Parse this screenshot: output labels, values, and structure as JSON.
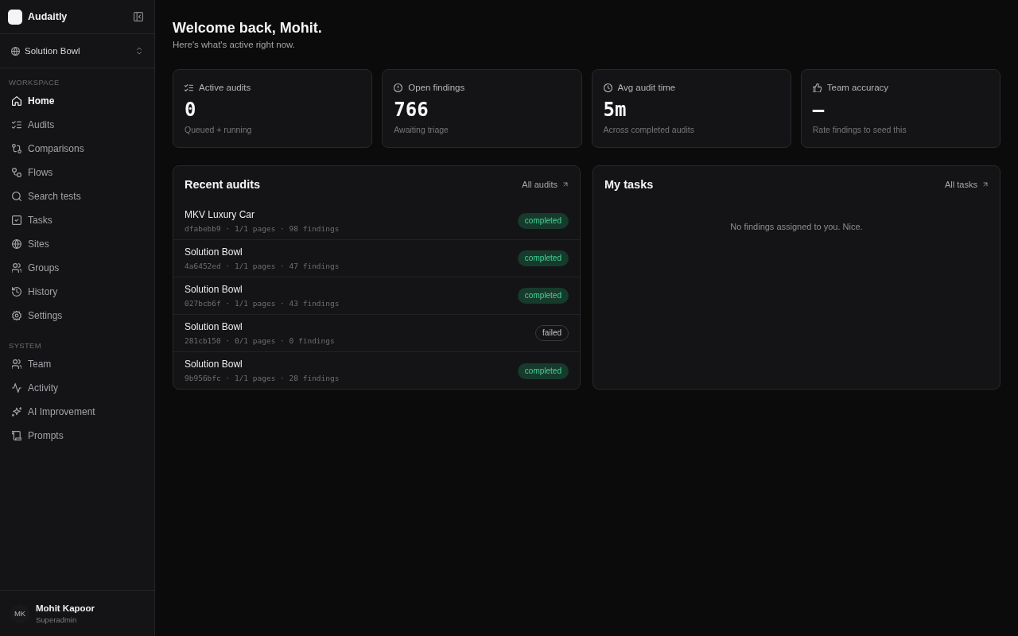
{
  "sidebar": {
    "app_name": "Audaitly",
    "workspace_switcher": {
      "label": "Solution Bowl"
    },
    "sections": [
      {
        "title": "WORKSPACE",
        "items": [
          {
            "label": "Home",
            "selected": true
          },
          {
            "label": "Audits",
            "selected": false
          },
          {
            "label": "Comparisons",
            "selected": false
          },
          {
            "label": "Flows",
            "selected": false
          },
          {
            "label": "Search tests",
            "selected": false
          },
          {
            "label": "Tasks",
            "selected": false
          },
          {
            "label": "Sites",
            "selected": false
          },
          {
            "label": "Groups",
            "selected": false
          },
          {
            "label": "History",
            "selected": false
          },
          {
            "label": "Settings",
            "selected": false
          }
        ]
      },
      {
        "title": "SYSTEM",
        "items": [
          {
            "label": "Team",
            "selected": false
          },
          {
            "label": "Activity",
            "selected": false
          },
          {
            "label": "AI Improvement",
            "selected": false
          },
          {
            "label": "Prompts",
            "selected": false
          }
        ]
      }
    ],
    "user": {
      "initials": "MK",
      "name": "Mohit Kapoor",
      "role": "Superadmin"
    }
  },
  "header": {
    "title": "Welcome back, Mohit.",
    "subtitle": "Here's what's active right now."
  },
  "stats": [
    {
      "label": "Active audits",
      "value": "0",
      "caption": "Queued + running"
    },
    {
      "label": "Open findings",
      "value": "766",
      "caption": "Awaiting triage"
    },
    {
      "label": "Avg audit time",
      "value": "5m",
      "caption": "Across completed audits"
    },
    {
      "label": "Team accuracy",
      "value": "—",
      "caption": "Rate findings to seed this"
    }
  ],
  "recent_audits": {
    "title": "Recent audits",
    "link": "All audits",
    "rows": [
      {
        "name": "MKV Luxury Car",
        "meta": "dfabebb9 · 1/1 pages · 98 findings",
        "status": {
          "label": "completed",
          "kind": "success"
        }
      },
      {
        "name": "Solution Bowl",
        "meta": "4a6452ed · 1/1 pages · 47 findings",
        "status": {
          "label": "completed",
          "kind": "success"
        }
      },
      {
        "name": "Solution Bowl",
        "meta": "027bcb6f · 1/1 pages · 43 findings",
        "status": {
          "label": "completed",
          "kind": "success"
        }
      },
      {
        "name": "Solution Bowl",
        "meta": "281cb150 · 0/1 pages · 0 findings",
        "status": {
          "label": "failed",
          "kind": "failure"
        }
      },
      {
        "name": "Solution Bowl",
        "meta": "9b956bfc · 1/1 pages · 28 findings",
        "status": {
          "label": "completed",
          "kind": "success"
        }
      }
    ]
  },
  "my_tasks": {
    "title": "My tasks",
    "link": "All tasks",
    "empty_message": "No findings assigned to you. Nice."
  }
}
